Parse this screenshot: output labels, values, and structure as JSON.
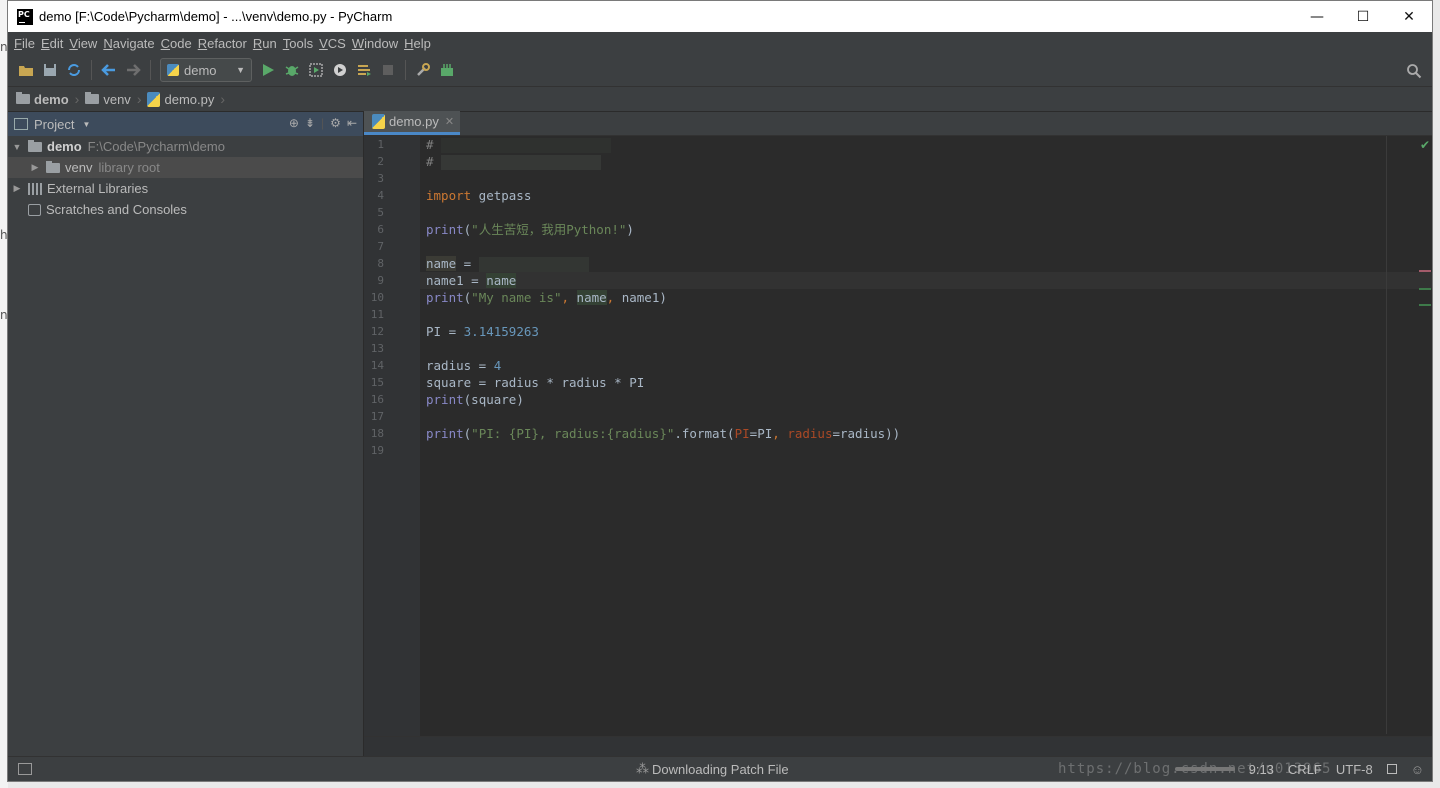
{
  "window": {
    "title": "demo [F:\\Code\\Pycharm\\demo] - ...\\venv\\demo.py - PyCharm",
    "controls": {
      "minimize": "—",
      "maximize": "☐",
      "close": "✕"
    }
  },
  "menu": [
    {
      "label": "File",
      "u": "F",
      "rest": "ile"
    },
    {
      "label": "Edit",
      "u": "E",
      "rest": "dit"
    },
    {
      "label": "View",
      "u": "V",
      "rest": "iew"
    },
    {
      "label": "Navigate",
      "u": "N",
      "rest": "avigate"
    },
    {
      "label": "Code",
      "u": "C",
      "rest": "ode"
    },
    {
      "label": "Refactor",
      "u": "R",
      "rest": "efactor"
    },
    {
      "label": "Run",
      "u": "R",
      "rest": "un"
    },
    {
      "label": "Tools",
      "u": "T",
      "rest": "ools"
    },
    {
      "label": "VCS",
      "u": "V",
      "rest": "CS"
    },
    {
      "label": "Window",
      "u": "W",
      "rest": "indow"
    },
    {
      "label": "Help",
      "u": "H",
      "rest": "elp"
    }
  ],
  "toolbar": {
    "run_config": "demo"
  },
  "breadcrumb": {
    "items": [
      "demo",
      "venv",
      "demo.py"
    ]
  },
  "project": {
    "header_label": "Project",
    "tree": [
      {
        "label": "demo",
        "hint": "F:\\Code\\Pycharm\\demo"
      },
      {
        "label": "venv",
        "hint": "library root"
      },
      {
        "label": "External Libraries"
      },
      {
        "label": "Scratches and Consoles"
      }
    ]
  },
  "editor": {
    "tab_label": "demo.py",
    "line_numbers": [
      "1",
      "2",
      "3",
      "4",
      "5",
      "6",
      "7",
      "8",
      "9",
      "10",
      "11",
      "12",
      "13",
      "14",
      "15",
      "16",
      "17",
      "18",
      "19"
    ],
    "comment1": "# ",
    "comment2": "# ",
    "kw_import": "import",
    "module": " getpass",
    "print_fn": "print",
    "str_slogan": "\"人生苦短，我用Python!\"",
    "var_name": "name",
    "eq": " = ",
    "var_name1": "name1",
    "str_my_name": "\"My name is\"",
    "var_pi": "PI",
    "num_pi": "3.14159263",
    "var_radius": "radius",
    "num_radius": "4",
    "var_square": "square",
    "str_format": "\"PI: {PI}, radius:{radius}\"",
    "format_method": ".format(",
    "param_pi": "PI",
    "param_radius": "radius"
  },
  "status": {
    "task": "Downloading Patch File",
    "position": "9:13",
    "line_sep": "CRLF",
    "encoding": "UTF-8",
    "watermark": "https://blog.csdn.net/u013965"
  },
  "colors": {
    "keyword": "#cc7832",
    "string": "#6a8759",
    "number": "#6897bb",
    "builtin": "#8888c6",
    "param": "#aa4926",
    "ok": "#59a869"
  }
}
